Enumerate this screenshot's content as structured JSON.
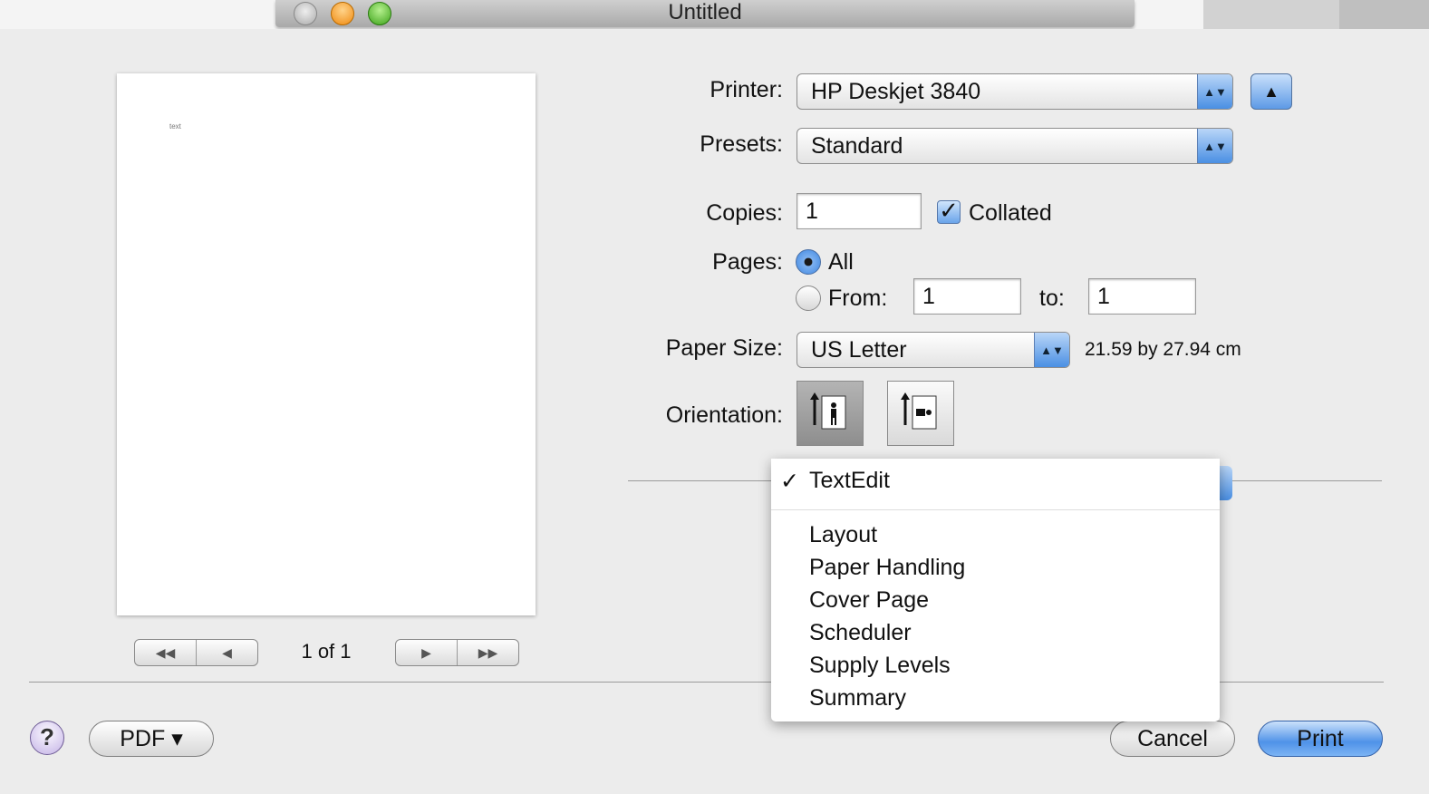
{
  "window": {
    "title": "Untitled"
  },
  "preview": {
    "page_text": "text",
    "page_count": "1 of 1"
  },
  "form": {
    "printer_label": "Printer:",
    "printer_value": "HP Deskjet 3840",
    "presets_label": "Presets:",
    "presets_value": "Standard",
    "copies_label": "Copies:",
    "copies_value": "1",
    "collated_label": "Collated",
    "collated_checked": true,
    "pages_label": "Pages:",
    "pages_all": "All",
    "pages_from": "From:",
    "pages_from_value": "1",
    "pages_to": "to:",
    "pages_to_value": "1",
    "paper_size_label": "Paper Size:",
    "paper_size_value": "US Letter",
    "paper_dims": "21.59 by 27.94 cm",
    "orientation_label": "Orientation:"
  },
  "menu": {
    "selected": "TextEdit",
    "items": [
      "Layout",
      "Paper Handling",
      "Cover Page",
      "Scheduler",
      "Supply Levels",
      "Summary"
    ]
  },
  "buttons": {
    "help": "?",
    "pdf": "PDF ▾",
    "cancel": "Cancel",
    "print": "Print"
  },
  "icons": {
    "check": "✓",
    "collapse": "▲",
    "stepper": "▲▼",
    "first_page": "◀◀",
    "prev_page": "◀",
    "next_page": "▶",
    "last_page": "▶▶"
  }
}
